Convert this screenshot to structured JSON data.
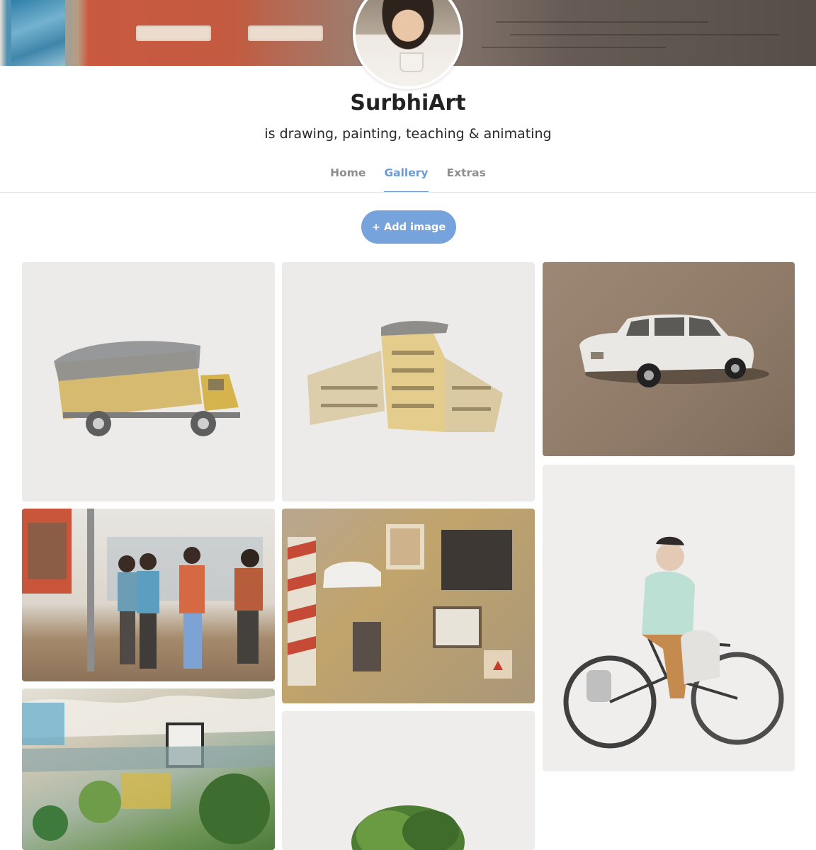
{
  "profile": {
    "name": "SurbhiArt",
    "tagline": "is drawing, painting, teaching & animating"
  },
  "tabs": [
    {
      "label": "Home",
      "active": false
    },
    {
      "label": "Gallery",
      "active": true
    },
    {
      "label": "Extras",
      "active": false
    }
  ],
  "actions": {
    "add_image_label": "+ Add image"
  },
  "colors": {
    "accent": "#6b9bd6",
    "button": "#77a3dc",
    "tab_inactive": "#8e8e8e",
    "name_text": "#222222"
  },
  "gallery": {
    "images": [
      {
        "subject": "truck-painting"
      },
      {
        "subject": "building-painting"
      },
      {
        "subject": "white-car-painting"
      },
      {
        "subject": "people-street-painting"
      },
      {
        "subject": "collage-painting"
      },
      {
        "subject": "cyclist-painting"
      },
      {
        "subject": "abstract-landscape-painting"
      },
      {
        "subject": "tree-painting"
      }
    ]
  }
}
